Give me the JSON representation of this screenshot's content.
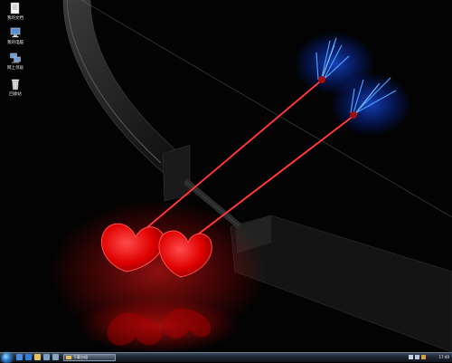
{
  "desktop": {
    "icons": [
      {
        "label": "我的文档"
      },
      {
        "label": "我的电脑"
      },
      {
        "label": "网上邻居"
      },
      {
        "label": "回收站"
      }
    ]
  },
  "taskbar": {
    "window_button": "下载分组",
    "clock": "17:40"
  }
}
